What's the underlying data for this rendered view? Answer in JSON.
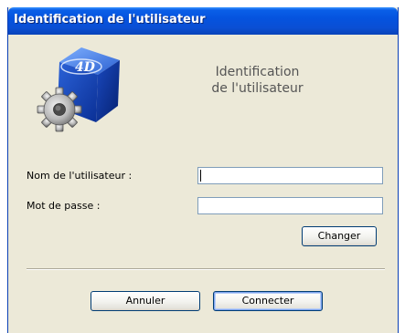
{
  "window": {
    "title": "Identification de l'utilisateur"
  },
  "header": {
    "logo_icon": "4d-cube-gear-icon",
    "title_line1": "Identification",
    "title_line2": "de l'utilisateur"
  },
  "form": {
    "username_label": "Nom de l'utilisateur :",
    "username_value": "",
    "password_label": "Mot de passe :",
    "password_value": "",
    "change_label": "Changer"
  },
  "footer": {
    "cancel_label": "Annuler",
    "connect_label": "Connecter"
  },
  "colors": {
    "titlebar": "#0553df",
    "dialog_bg": "#ece9d8",
    "field_border": "#7f9db9",
    "button_border": "#003c74"
  }
}
